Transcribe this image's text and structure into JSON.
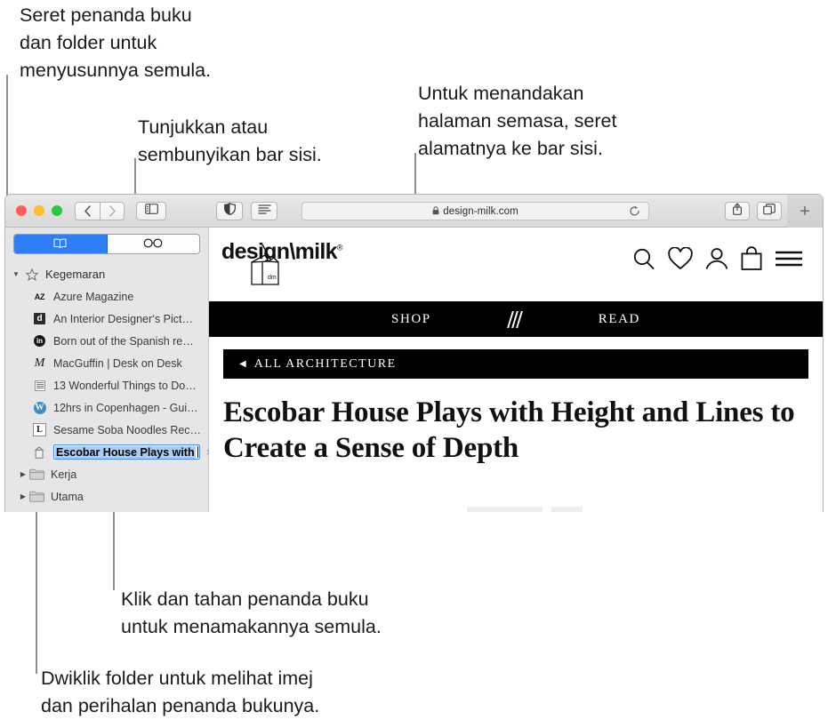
{
  "annotations": {
    "top_left": "Seret penanda buku\ndan folder untuk\nmenyusunnya semula.",
    "top_middle": "Tunjukkan atau\nsembunyikan bar sisi.",
    "top_right": "Untuk menandakan\nhalaman semasa, seret\nalamatnya ke bar sisi.",
    "bottom_middle": "Klik dan tahan penanda buku\nuntuk menamakannya semula.",
    "bottom_left": "Dwiklik folder untuk melihat imej\ndan perihalan penanda bukunya."
  },
  "browser": {
    "traffic_lights": [
      "close-red",
      "minimize-yellow",
      "zoom-green"
    ],
    "back_label": "‹",
    "forward_label": "›",
    "sidebar_toggle_name": "sidebar-toggle",
    "privacy_report_name": "privacy-shield",
    "reader_view_name": "reader-view",
    "address": {
      "value": "design-milk.com",
      "lock": "🔒",
      "reload": "⟳"
    },
    "share_name": "share-button",
    "tab_overview_name": "tab-overview-button",
    "new_tab_label": "+"
  },
  "sidebar": {
    "tabs": [
      {
        "name": "bookmarks-tab",
        "icon": "book-icon",
        "selected": true
      },
      {
        "name": "reading-list-tab",
        "icon": "glasses-icon",
        "selected": false
      }
    ],
    "items": [
      {
        "label": "Kegemaran",
        "icon": "star-icon",
        "type": "group",
        "disclosure": "▼"
      },
      {
        "label": "Azure Magazine",
        "icon": "AZ",
        "type": "bookmark"
      },
      {
        "label": "An Interior Designer‘s Pict…",
        "icon": "d",
        "type": "bookmark"
      },
      {
        "label": "Born out of the Spanish re…",
        "icon": "in",
        "type": "bookmark"
      },
      {
        "label": "MacGuffin | Desk on Desk",
        "icon": "M",
        "type": "bookmark"
      },
      {
        "label": "13 Wonderful Things to Do…",
        "icon": "grid",
        "type": "bookmark"
      },
      {
        "label": "12hrs in Copenhagen - Gui…",
        "icon": "W",
        "type": "bookmark"
      },
      {
        "label": "Sesame Soba Noodles Rec…",
        "icon": "L",
        "type": "bookmark"
      }
    ],
    "editing_item": {
      "label": "Escobar House Plays with ",
      "icon": "milk-carton-icon",
      "dismiss": "×"
    },
    "folders": [
      {
        "label": "Kerja",
        "disclosure": "▶",
        "icon": "folder-icon"
      },
      {
        "label": "Utama",
        "disclosure": "▶",
        "icon": "folder-icon"
      }
    ]
  },
  "page": {
    "logo": {
      "text_left": "design",
      "slash": "\\",
      "text_right": "milk",
      "reg": "®",
      "carton_label": "dm"
    },
    "nav_icons": [
      "search-icon",
      "heart-icon",
      "account-icon",
      "bag-icon",
      "menu-icon"
    ],
    "nav_links": {
      "left": "SHOP",
      "right": "READ",
      "center": "slashes-logo"
    },
    "breadcrumb": {
      "arrow": "◀",
      "label": "ALL ARCHITECTURE"
    },
    "headline": "Escobar House Plays with Height and Lines to Create a Sense of Depth"
  },
  "colors": {
    "accent_blue": "#2f7ef6",
    "selection_blue": "#a9cdf7",
    "sidebar_bg": "#e6e6e8",
    "black": "#000000",
    "leader": "#8e8e8e"
  }
}
